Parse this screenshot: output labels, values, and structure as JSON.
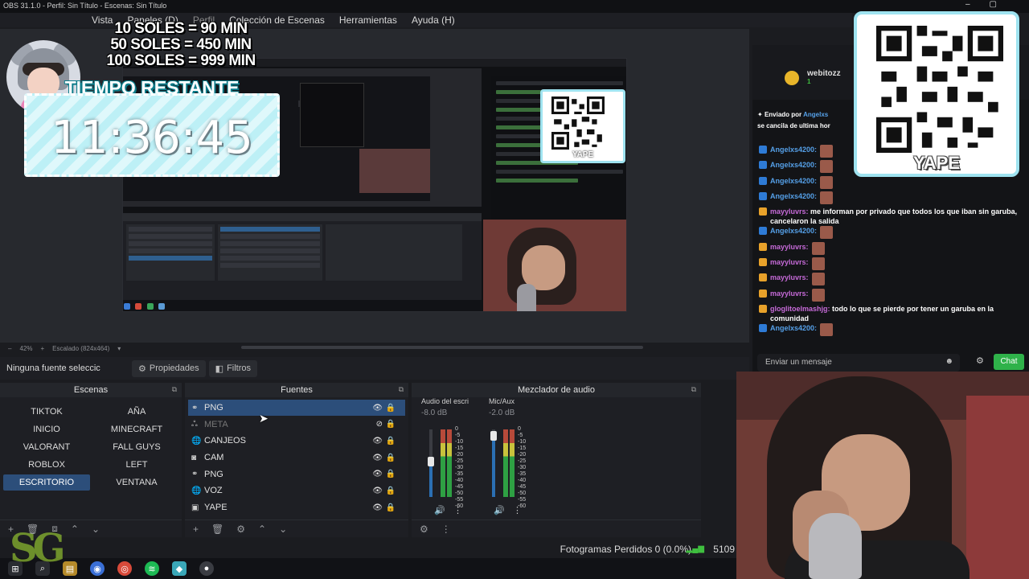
{
  "window": {
    "title": "OBS 31.1.0 - Perfil: Sin Título - Escenas: Sin Título"
  },
  "menu": {
    "items": [
      "Vista",
      "Paneles (D)",
      "Perfil",
      "Colección de Escenas",
      "Herramientas",
      "Ayuda (H)"
    ]
  },
  "overlay": {
    "pricing": [
      "10 SOLES = 90 MIN",
      "50 SOLES = 450 MIN",
      "100 SOLES = 999 MIN"
    ],
    "timer_title": "TIEMPO RESTANTE",
    "timer_value": "11:36:45",
    "qr_label": "YAPE",
    "logo": "SG"
  },
  "preview": {
    "zoom": "42%",
    "scale_label": "Escalado (824x464)"
  },
  "source_toolbar": {
    "no_selection": "Ninguna fuente seleccic",
    "properties": "Propiedades",
    "filters": "Filtros"
  },
  "scenes": {
    "title": "Escenas",
    "items": [
      "TIKTOK",
      "AÑA",
      "INICIO",
      "MINECRAFT",
      "VALORANT",
      "FALL GUYS",
      "ROBLOX",
      "LEFT",
      "ESCRITORIO",
      "VENTANA"
    ],
    "selected": "ESCRITORIO"
  },
  "sources": {
    "title": "Fuentes",
    "items": [
      {
        "name": "PNG",
        "icon": "link-icon"
      },
      {
        "name": "META",
        "icon": "meta-icon"
      },
      {
        "name": "CANJEOS",
        "icon": "globe-icon"
      },
      {
        "name": "CAM",
        "icon": "camera-icon"
      },
      {
        "name": "PNG",
        "icon": "link-icon"
      },
      {
        "name": "VOZ",
        "icon": "globe-icon"
      },
      {
        "name": "YAPE",
        "icon": "image-icon"
      }
    ]
  },
  "mixer": {
    "title": "Mezclador de audio",
    "channels": [
      {
        "name": "Audio del escri",
        "db": "-8.0 dB"
      },
      {
        "name": "Mic/Aux",
        "db": "-2.0 dB"
      }
    ],
    "scale": [
      "0",
      "-5",
      "-10",
      "-15",
      "-20",
      "-25",
      "-30",
      "-35",
      "-40",
      "-45",
      "-50",
      "-55",
      "-60"
    ]
  },
  "status": {
    "frames_lost": "Fotogramas Perdidos 0 (0.0%)",
    "bitrate": "5109"
  },
  "chat": {
    "header_user": "webitozz",
    "header_sub": "1",
    "sent_by_prefix": "Enviado por",
    "sent_by_user": "Angelxs",
    "sent_text": "se cancila de ultima hor",
    "messages": [
      {
        "user": "Angelxs4200:",
        "text": "",
        "color": "#55a0e8",
        "icon": "#2e7bd6"
      },
      {
        "user": "Angelxs4200:",
        "text": "",
        "color": "#55a0e8",
        "icon": "#2e7bd6"
      },
      {
        "user": "Angelxs4200:",
        "text": "",
        "color": "#55a0e8",
        "icon": "#2e7bd6"
      },
      {
        "user": "Angelxs4200:",
        "text": "",
        "color": "#55a0e8",
        "icon": "#2e7bd6"
      },
      {
        "user": "mayyluvrs:",
        "text": "me informan por privado que todos los que iban sin garuba, cancelaron la salida",
        "color": "#c66ad8",
        "icon": "#e8a22a"
      },
      {
        "user": "Angelxs4200:",
        "text": "",
        "color": "#55a0e8",
        "icon": "#2e7bd6"
      },
      {
        "user": "mayyluvrs:",
        "text": "",
        "color": "#c66ad8",
        "icon": "#e8a22a"
      },
      {
        "user": "mayyluvrs:",
        "text": "",
        "color": "#c66ad8",
        "icon": "#e8a22a"
      },
      {
        "user": "mayyluvrs:",
        "text": "",
        "color": "#c66ad8",
        "icon": "#e8a22a"
      },
      {
        "user": "mayyluvrs:",
        "text": "",
        "color": "#c66ad8",
        "icon": "#e8a22a"
      },
      {
        "user": "gloglitoelmashjg:",
        "text": "todo lo que se pierde por tener un garuba en la comunidad",
        "color": "#c66ad8",
        "icon": "#e8a22a"
      },
      {
        "user": "Angelxs4200:",
        "text": "",
        "color": "#55a0e8",
        "icon": "#2e7bd6"
      }
    ],
    "input_placeholder": "Enviar un mensaje",
    "send_label": "Chat"
  },
  "colors": {
    "accent": "#2c4e7a",
    "chat_send": "#2fb24a",
    "qr_border": "#9fe3f0"
  }
}
